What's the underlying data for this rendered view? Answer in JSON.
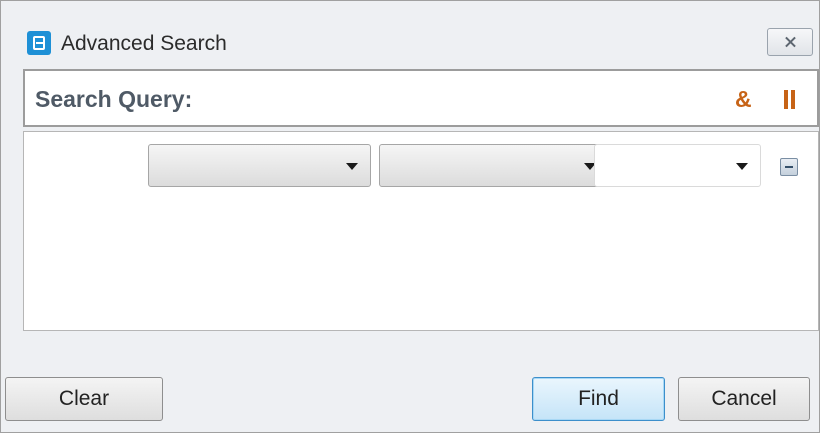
{
  "window": {
    "title": "Advanced Search",
    "close_icon": "close-icon",
    "app_icon": "app-icon"
  },
  "query": {
    "label": "Search Query:",
    "and_operator": "&",
    "or_operator": "||",
    "operator_color": "#c76316"
  },
  "condition_row": {
    "field_value": "",
    "comparator_value": "",
    "value_value": "",
    "remove_icon": "minus-icon"
  },
  "buttons": {
    "clear": "Clear",
    "find": "Find",
    "cancel": "Cancel"
  }
}
